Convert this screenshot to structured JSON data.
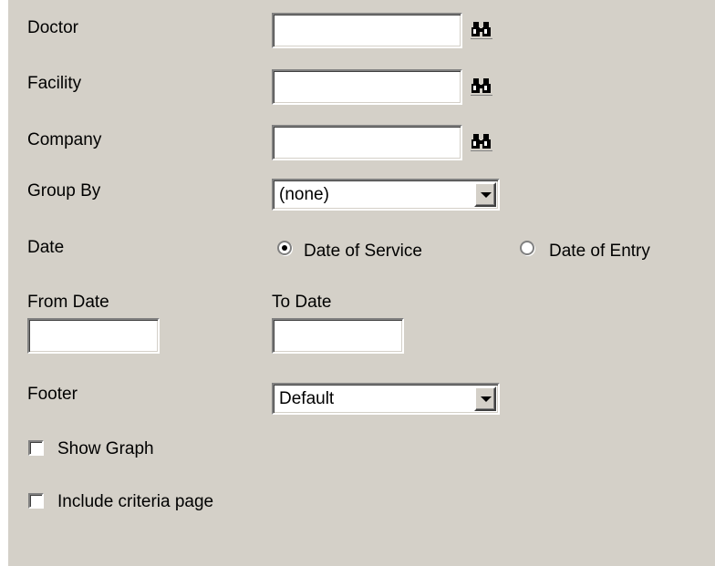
{
  "form": {
    "doctor_label": "Doctor",
    "facility_label": "Facility",
    "company_label": "Company",
    "group_by_label": "Group By",
    "group_by_value": "(none)",
    "date_label": "Date",
    "date_options": [
      "Date of Service",
      "Date of Entry"
    ],
    "date_selected": "Date of Service",
    "from_date_label": "From Date",
    "to_date_label": "To Date",
    "footer_label": "Footer",
    "footer_value": "Default",
    "show_graph_label": "Show Graph",
    "show_graph_checked": false,
    "criteria_page_label": "Include criteria page",
    "criteria_page_checked": false
  },
  "icons": {
    "lookup": "binoculars-icon"
  },
  "colors": {
    "dialog_bg": "#d4d0c8"
  }
}
